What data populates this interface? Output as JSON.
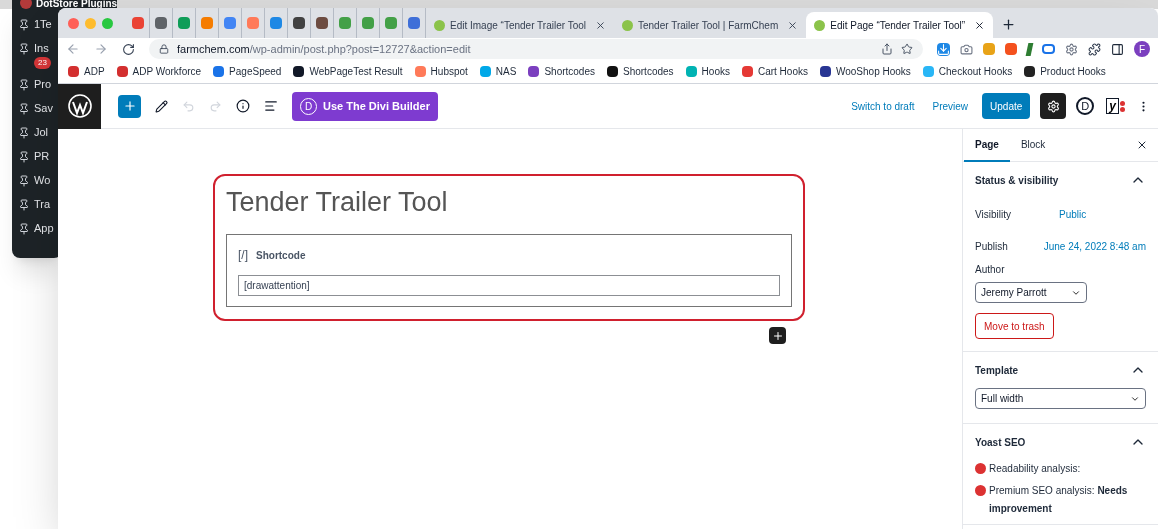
{
  "background_window": {
    "title": "DotStore Plugins",
    "menu": [
      {
        "label": "1Te"
      },
      {
        "label": "Ins",
        "badge": "23"
      },
      {
        "label": "Pro"
      },
      {
        "label": "Sav"
      },
      {
        "label": "Jol"
      },
      {
        "label": "PR"
      },
      {
        "label": "Wo"
      },
      {
        "label": "Tra"
      },
      {
        "label": "App"
      }
    ]
  },
  "browser": {
    "pinned_tabs": [
      {
        "color": "#ea4335"
      },
      {
        "color": "#5f6368"
      },
      {
        "color": "#0f9d58"
      },
      {
        "color": "#f57c00"
      },
      {
        "color": "#4285f4"
      },
      {
        "color": "#ff7a59"
      },
      {
        "color": "#1e88e5"
      },
      {
        "color": "#424242"
      },
      {
        "color": "#6d4c41"
      },
      {
        "color": "#43a047"
      },
      {
        "color": "#43a047"
      },
      {
        "color": "#43a047"
      },
      {
        "color": "#3f6fd8"
      }
    ],
    "tabs": [
      {
        "title": "Edit Image “Tender Trailer Tool",
        "selected": false
      },
      {
        "title": "Tender Trailer Tool | FarmChem",
        "selected": false
      },
      {
        "title": "Edit Page “Tender Trailer Tool”",
        "selected": true
      }
    ],
    "url": {
      "host": "farmchem.com",
      "path": "/wp-admin/post.php?post=12727&action=edit"
    },
    "profile_initial": "F",
    "bookmarks": [
      {
        "label": "ADP",
        "color": "#d32f2f"
      },
      {
        "label": "ADP Workforce",
        "color": "#d32f2f"
      },
      {
        "label": "PageSpeed",
        "color": "#1a73e8"
      },
      {
        "label": "WebPageTest Result",
        "color": "#111827"
      },
      {
        "label": "Hubspot",
        "color": "#ff7a59"
      },
      {
        "label": "NAS",
        "color": "#00a8e8"
      },
      {
        "label": "Shortcodes",
        "color": "#7b3fbf"
      },
      {
        "label": "Shortcodes",
        "color": "#111111"
      },
      {
        "label": "Hooks",
        "color": "#00b3b3"
      },
      {
        "label": "Cart Hooks",
        "color": "#e53935"
      },
      {
        "label": "WooShop Hooks",
        "color": "#283593"
      },
      {
        "label": "Checkout Hooks",
        "color": "#29b6f6"
      },
      {
        "label": "Product Hooks",
        "color": "#222222"
      }
    ]
  },
  "editor": {
    "toolbar": {
      "divi_logo": "D",
      "divi_button": "Use The Divi Builder",
      "switch_to_draft": "Switch to draft",
      "preview": "Preview",
      "update": "Update",
      "divi_icon": "D",
      "yoast_icon": "y",
      "settings_active": true
    },
    "title": "Tender Trailer Tool",
    "block": {
      "icon": "[/]",
      "label": "Shortcode",
      "value": "[drawattention]",
      "selected": true
    }
  },
  "sidebar": {
    "tabs": [
      {
        "label": "Page",
        "selected": true
      },
      {
        "label": "Block",
        "selected": false
      }
    ],
    "panels": [
      {
        "kind": "status",
        "title": "Status & visibility",
        "expanded": true,
        "visibility_label": "Visibility",
        "visibility": "Public",
        "publish_label": "Publish",
        "publish": "June 24, 2022 8:48 am",
        "author_label": "Author",
        "author": "Jeremy Parrott",
        "trash": "Move to trash"
      },
      {
        "kind": "template",
        "title": "Template",
        "expanded": true,
        "value": "Full width"
      },
      {
        "kind": "yoast",
        "title": "Yoast SEO",
        "expanded": true,
        "items": [
          {
            "text": "Readability analysis:",
            "color": "#dc3232"
          },
          {
            "text": "Premium SEO analysis: **Needs improvement**",
            "color": "#dc3232"
          }
        ]
      }
    ]
  }
}
